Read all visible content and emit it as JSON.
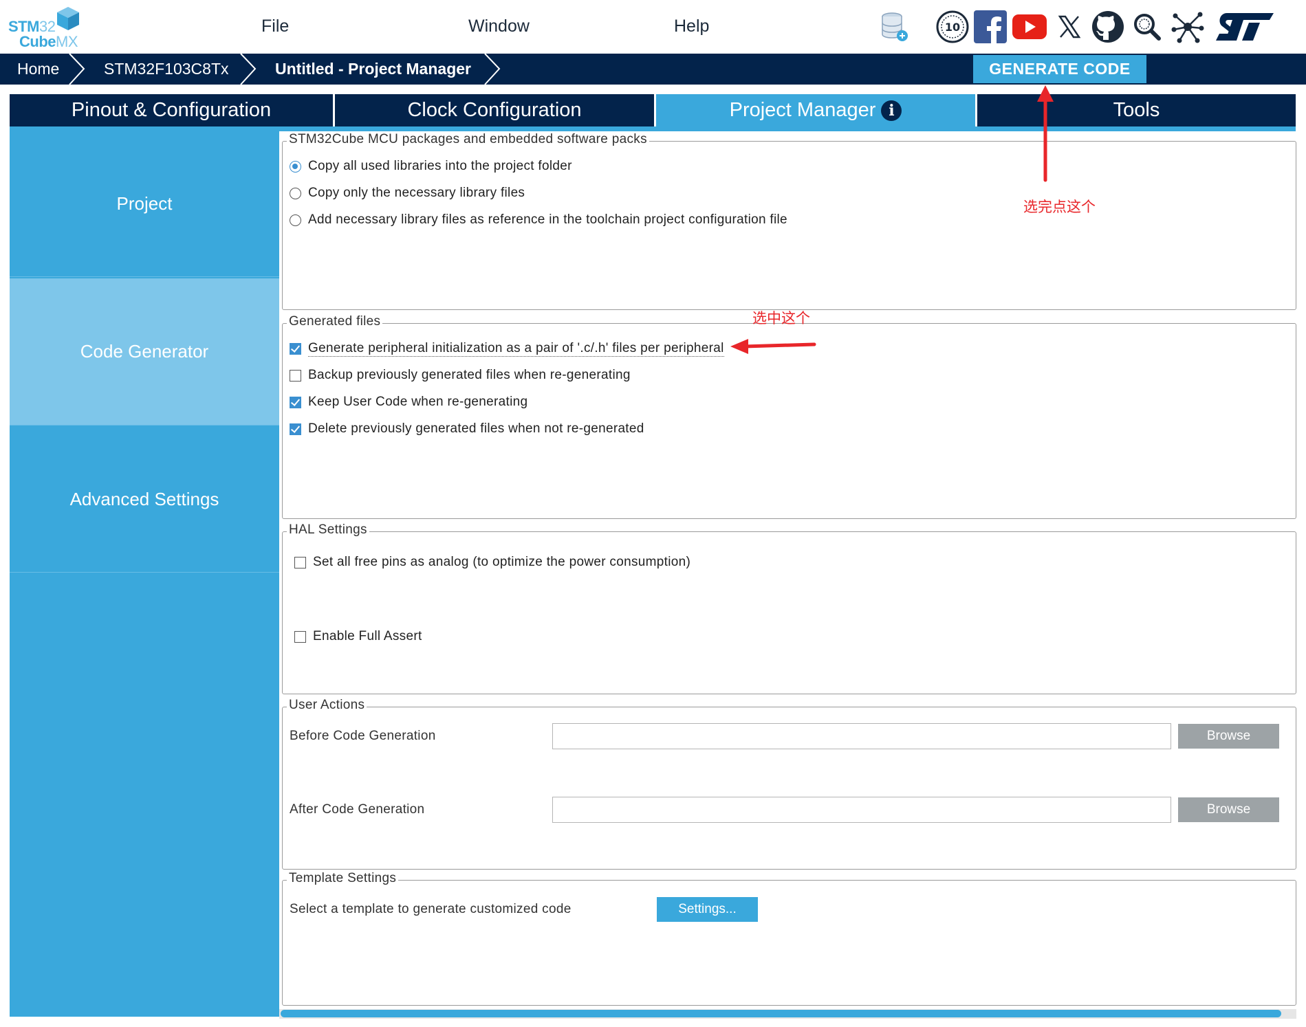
{
  "app": {
    "logo_line1_bold": "STM",
    "logo_line1_light": "32",
    "logo_line2_bold": "Cube",
    "logo_line2_light": "MX"
  },
  "menu": [
    "File",
    "Window",
    "Help"
  ],
  "toolbar_icons": [
    "database-update-icon",
    "anniversary-badge-icon",
    "facebook-icon",
    "youtube-icon",
    "x-icon",
    "github-icon",
    "search-icon",
    "network-icon",
    "st-logo-icon"
  ],
  "breadcrumb": [
    "Home",
    "STM32F103C8Tx",
    "Untitled - Project Manager"
  ],
  "generate_button": "GENERATE CODE",
  "tabs": [
    {
      "label": "Pinout & Configuration",
      "active": false
    },
    {
      "label": "Clock Configuration",
      "active": false
    },
    {
      "label": "Project Manager",
      "active": true
    },
    {
      "label": "Tools",
      "active": false
    }
  ],
  "sidebar": [
    {
      "label": "Project",
      "active": false
    },
    {
      "label": "Code Generator",
      "active": true
    },
    {
      "label": "Advanced Settings",
      "active": false
    }
  ],
  "packs": {
    "legend": "STM32Cube MCU packages and embedded software packs",
    "options": [
      {
        "label": "Copy all used libraries into the project folder",
        "selected": true
      },
      {
        "label": "Copy only the necessary library files",
        "selected": false
      },
      {
        "label": "Add necessary library files as reference in the toolchain project configuration file",
        "selected": false
      }
    ]
  },
  "generated_files": {
    "legend": "Generated files",
    "options": [
      {
        "label": "Generate peripheral initialization as a pair of '.c/.h' files per peripheral",
        "checked": true
      },
      {
        "label": "Backup previously generated files when re-generating",
        "checked": false
      },
      {
        "label": "Keep User Code when re-generating",
        "checked": true
      },
      {
        "label": "Delete previously generated files when not re-generated",
        "checked": true
      }
    ]
  },
  "hal": {
    "legend": "HAL Settings",
    "options": [
      {
        "label": "Set all free pins as analog (to optimize the power consumption)",
        "checked": false
      },
      {
        "label": "Enable Full Assert",
        "checked": false
      }
    ]
  },
  "user_actions": {
    "legend": "User Actions",
    "before_label": "Before Code Generation",
    "before_value": "",
    "after_label": "After Code Generation",
    "after_value": "",
    "browse_label": "Browse"
  },
  "template": {
    "legend": "Template Settings",
    "label": "Select a template to generate customized code",
    "button": "Settings..."
  },
  "annotations": {
    "generate_hint": "选完点这个",
    "checkbox_hint": "选中这个"
  },
  "colors": {
    "navy": "#03234b",
    "accent": "#3aa8dc",
    "sidebar_active": "#7ec6ea",
    "annotation_red": "#e8262a"
  }
}
